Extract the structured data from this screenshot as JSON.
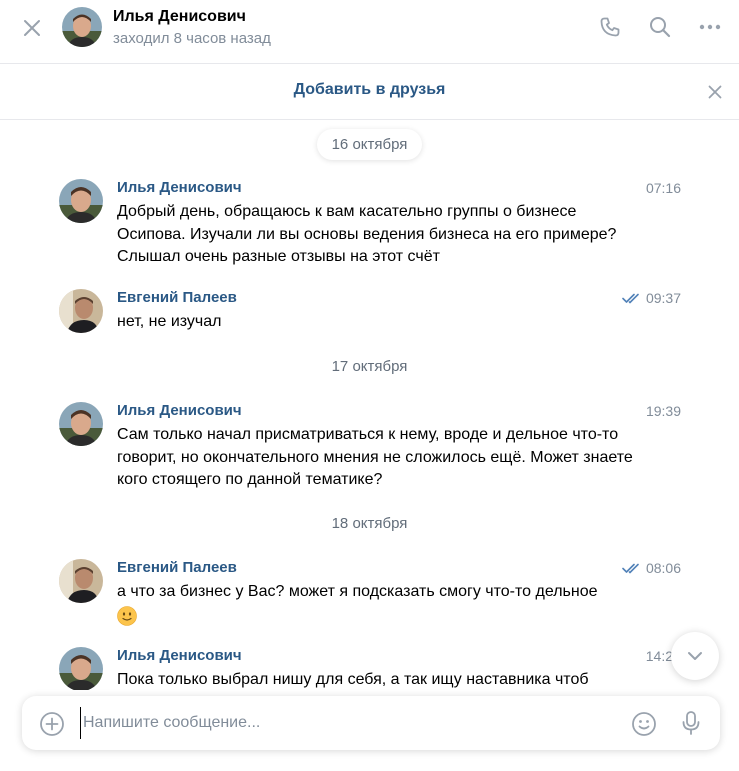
{
  "header": {
    "name": "Илья Денисович",
    "status": "заходил 8 часов назад",
    "close_icon": "close-icon",
    "call_icon": "phone-icon",
    "search_icon": "search-icon",
    "more_icon": "more-icon"
  },
  "friend_bar": {
    "label": "Добавить в друзья"
  },
  "dates": [
    "16 октября",
    "17 октября",
    "18 октября"
  ],
  "messages": [
    {
      "author": "Илья Денисович",
      "time": "07:16",
      "text": "Добрый день, обращаюсь к вам касательно группы о бизнесе Осипова. Изучали ли вы основы ведения бизнеса на его примере? Слышал очень разные отзывы на этот счёт",
      "read": false
    },
    {
      "author": "Евгений Палеев",
      "time": "09:37",
      "text": "нет, не изучал",
      "read": true
    },
    {
      "author": "Илья Денисович",
      "time": "19:39",
      "text": "Сам только начал присматриваться к нему, вроде и дельное что-то говорит, но окончательного мнения не сложилось ещё. Может знаете кого стоящего по данной тематике?",
      "read": false
    },
    {
      "author": "Евгений Палеев",
      "time": "08:06",
      "text": "а что за бизнес у Вас? может я подсказать смогу что-то дельное",
      "read": true
    },
    {
      "author": "Илья Денисович",
      "time": "14:2",
      "text": "Пока только выбрал нишу для себя, а так ищу наставника чтоб",
      "read": false
    }
  ],
  "composer": {
    "placeholder": "Напишите сообщение..."
  },
  "colors": {
    "link": "#2a5885",
    "muted": "#818c99",
    "accent": "#5181b8"
  }
}
